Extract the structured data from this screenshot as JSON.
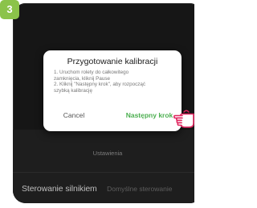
{
  "step": {
    "number": "3"
  },
  "background": {
    "title": ""
  },
  "dialog": {
    "title": "Przygotowanie kalibracji",
    "instructions": [
      "1. Uruchom rolety do całkowitego",
      "zamknięcia, kliknij Pause",
      "2. Kliknij \"Następny krok\", aby rozpocząć",
      "szybką kalibrację"
    ],
    "cancel_label": "Cancel",
    "next_label": "Następny krok"
  },
  "settings_sheet": {
    "title": "Ustawienia",
    "row_label": "Sterowanie silnikiem",
    "row_value": "Domyślne sterowanie"
  },
  "colors": {
    "badge": "#8bc34a",
    "accent": "#4caf50",
    "hand_pointer": "#e0245e",
    "phone_background": "#161616"
  },
  "icons": {
    "pointer": "hand-pointer-icon"
  }
}
